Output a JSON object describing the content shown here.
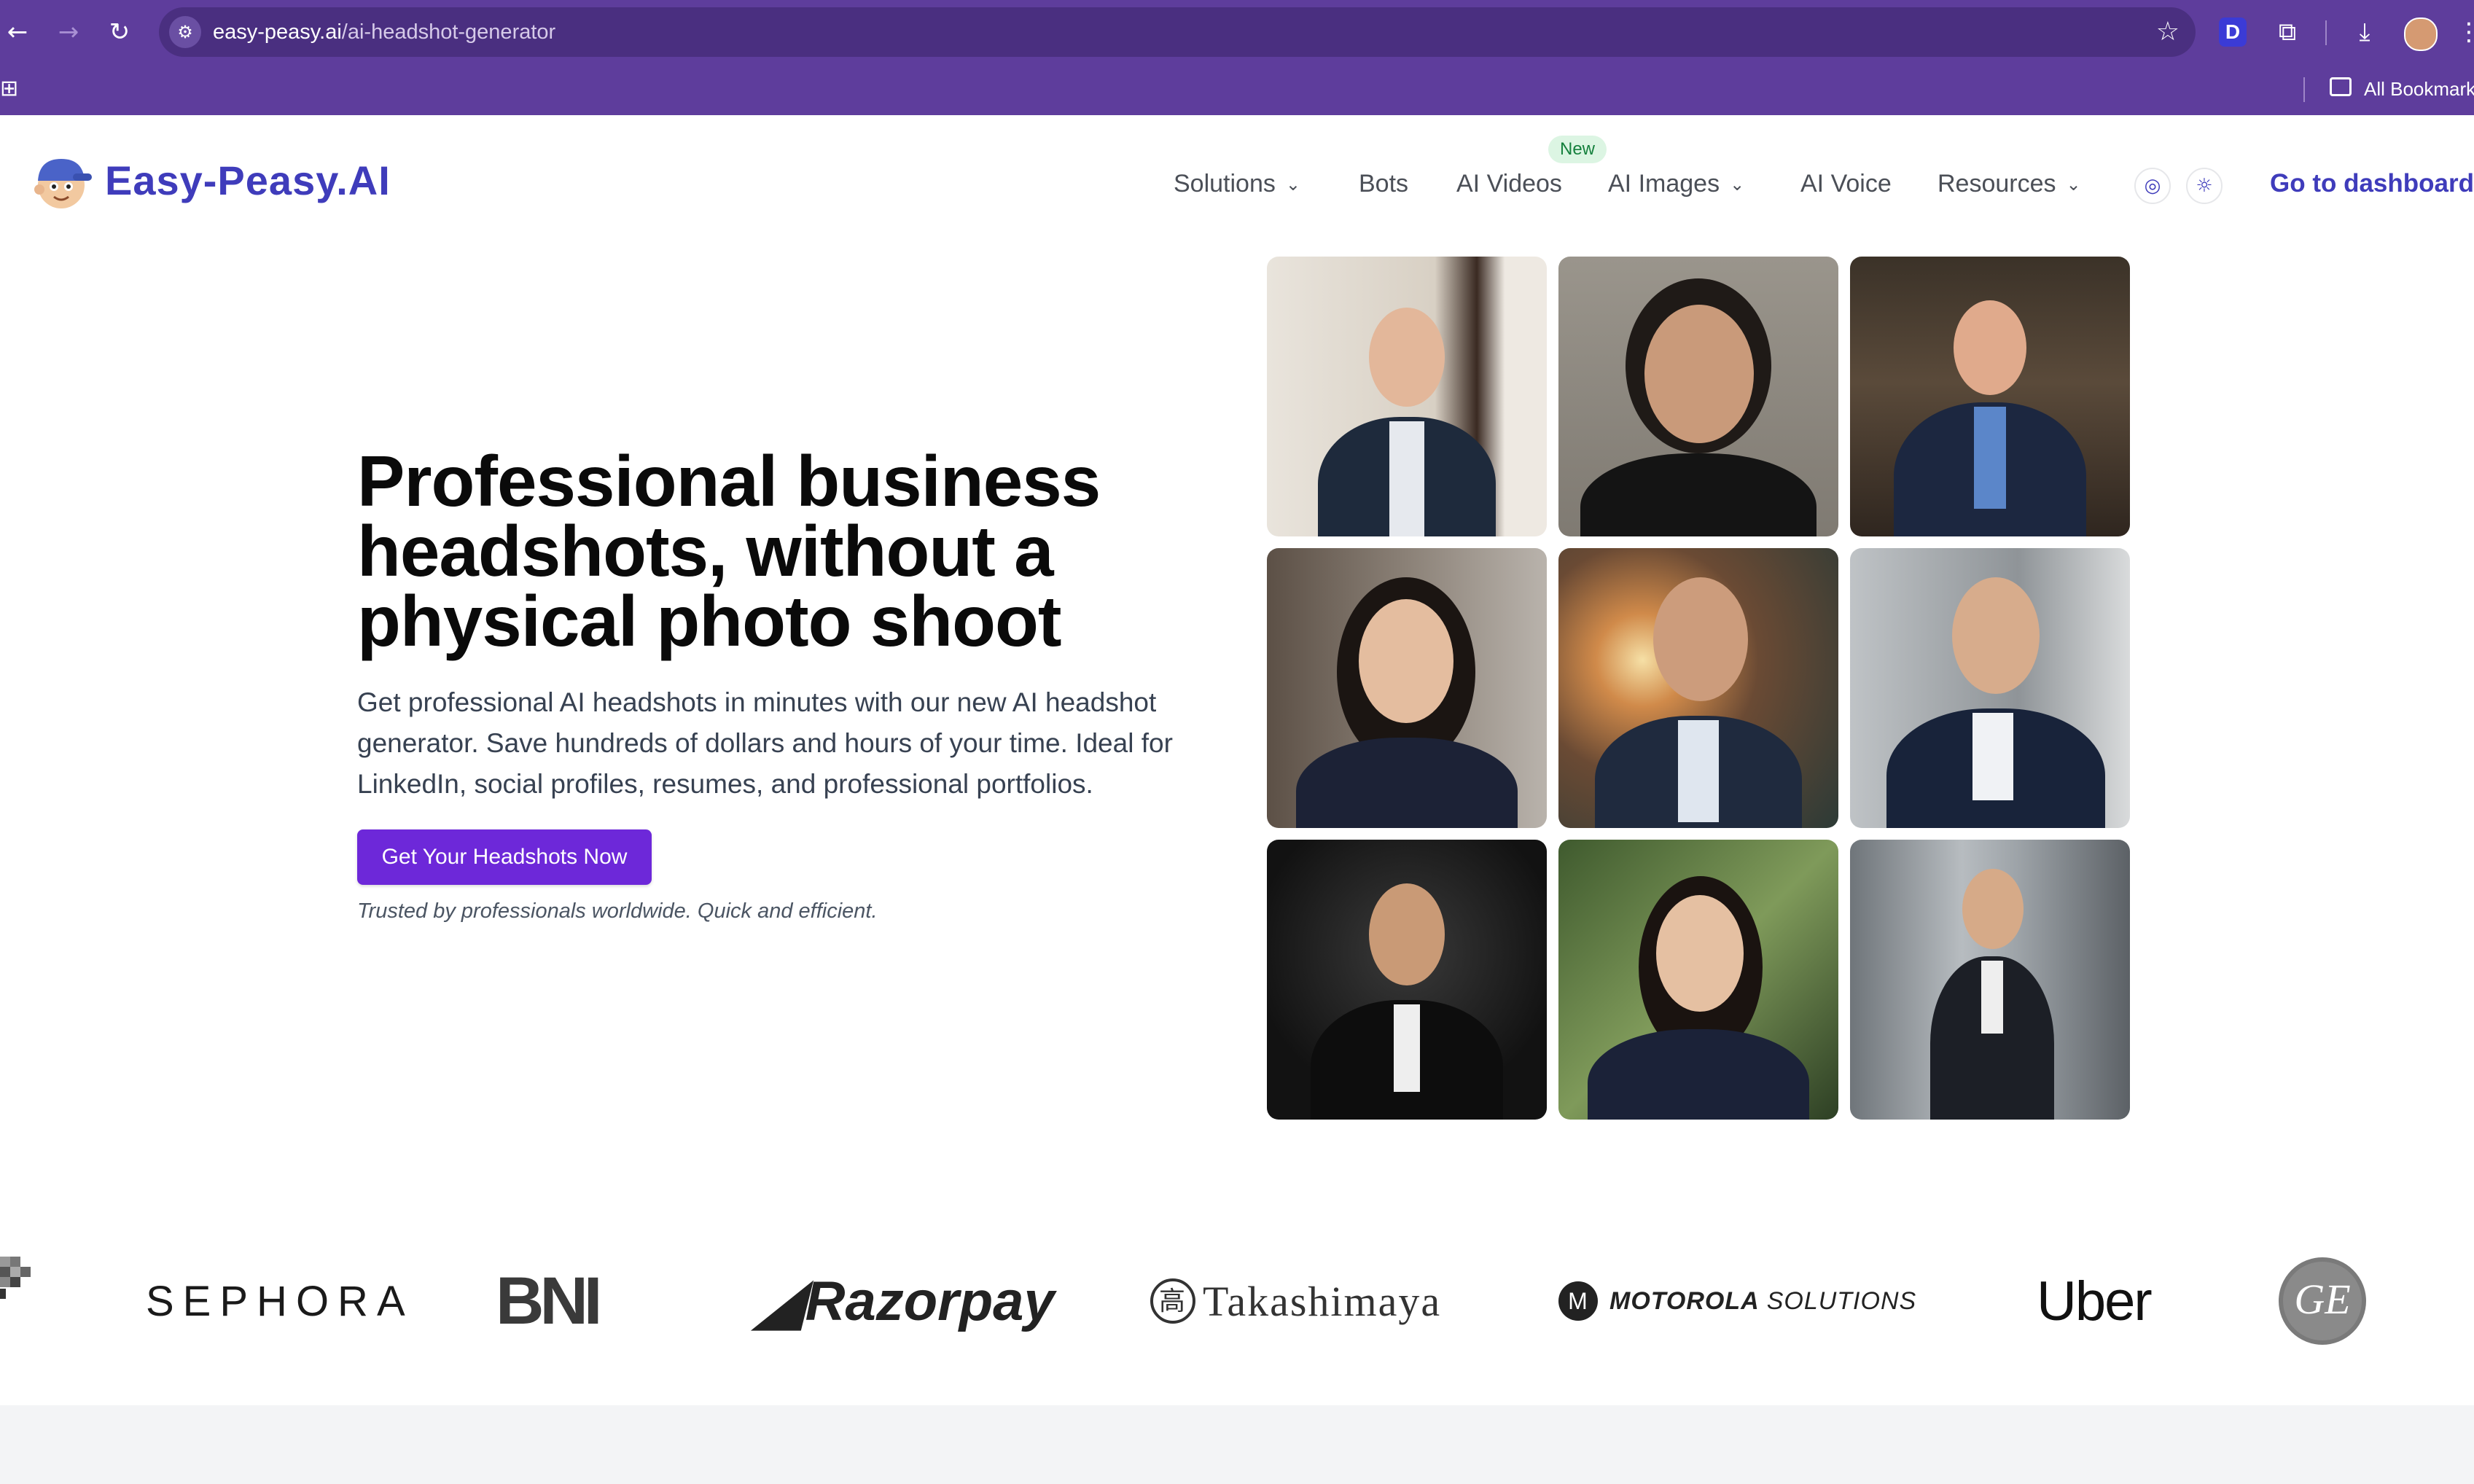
{
  "browser": {
    "url_host": "easy-peasy.ai",
    "url_path": "/ai-headshot-generator",
    "bookmarks_label": "All Bookmarks",
    "extension_letter": "D"
  },
  "site": {
    "logo_text": "Easy-Peasy.AI",
    "nav": {
      "solutions": "Solutions",
      "bots": "Bots",
      "ai_videos": "AI Videos",
      "new_badge": "New",
      "ai_images": "AI Images",
      "ai_voice": "AI Voice",
      "resources": "Resources"
    },
    "dashboard_link": "Go to dashboard"
  },
  "hero": {
    "title_line1": "Professional business",
    "title_line2": "headshots, without a",
    "title_line3": "physical photo shoot",
    "subtitle_line1": "Get professional AI headshots in minutes with our new AI headshot",
    "subtitle_line2": "generator. Save hundreds of dollars and hours of your time. Ideal for",
    "subtitle_line3": "LinkedIn, social profiles, resumes, and professional portfolios.",
    "cta_label": "Get Your Headshots Now",
    "trusted_text": "Trusted by professionals worldwide. Quick and efficient."
  },
  "logos": {
    "sephora": "SEPHORA",
    "bni": "BNI",
    "razorpay": "Razorpay",
    "takashimaya": "Takashimaya",
    "motorola_bold": "MOTOROLA",
    "motorola_light": "SOLUTIONS",
    "uber": "Uber",
    "ge": "GE"
  },
  "colors": {
    "browser_chrome": "#5e3d9c",
    "brand": "#3f3cbb",
    "cta": "#6d28d9",
    "badge_bg": "#dcf5e3",
    "badge_text": "#15803d"
  },
  "icons": {
    "back": "arrow-left-icon",
    "forward": "arrow-right-icon",
    "reload": "reload-icon",
    "site_info": "tune-icon",
    "bookmark": "star-icon",
    "extensions": "puzzle-icon",
    "download": "download-icon",
    "language": "globe-icon",
    "theme": "sun-icon"
  }
}
